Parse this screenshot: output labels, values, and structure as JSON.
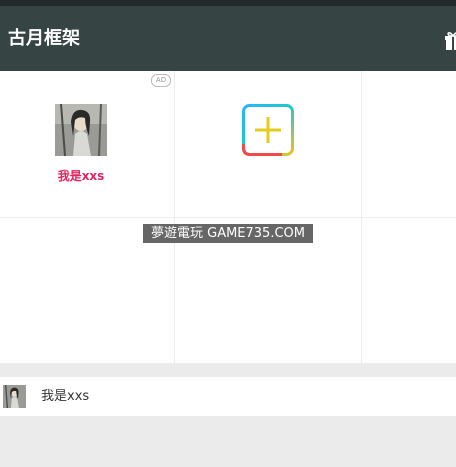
{
  "app": {
    "title": "古月框架",
    "bar_color": "#364444"
  },
  "header": {
    "gift_icon": "gift-icon"
  },
  "grid": {
    "ad_label": "AD",
    "user_cell": {
      "name": "我是xxs",
      "name_color": "#e5245e",
      "avatar_icon": "avatar-portrait"
    },
    "add_button_icon": "plus-icon"
  },
  "watermark": "夢遊電玩 GAME735.COM",
  "bottom_bar": {
    "user_name": "我是xxs"
  }
}
